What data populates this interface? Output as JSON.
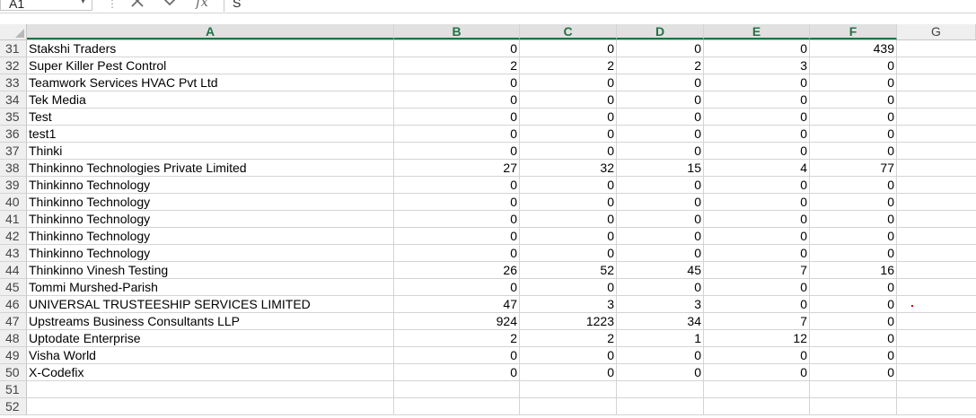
{
  "formula_bar": {
    "name_box": "A1",
    "formula": "S",
    "fx_label": "fx"
  },
  "columns": [
    "A",
    "B",
    "C",
    "D",
    "E",
    "F",
    "G"
  ],
  "rows": [
    {
      "n": "31",
      "a": "Stakshi Traders",
      "b": "0",
      "c": "0",
      "d": "0",
      "e": "0",
      "f": "439"
    },
    {
      "n": "32",
      "a": "Super Killer Pest Control",
      "b": "2",
      "c": "2",
      "d": "2",
      "e": "3",
      "f": "0"
    },
    {
      "n": "33",
      "a": "Teamwork Services HVAC Pvt Ltd",
      "b": "0",
      "c": "0",
      "d": "0",
      "e": "0",
      "f": "0"
    },
    {
      "n": "34",
      "a": "Tek Media",
      "b": "0",
      "c": "0",
      "d": "0",
      "e": "0",
      "f": "0"
    },
    {
      "n": "35",
      "a": "Test",
      "b": "0",
      "c": "0",
      "d": "0",
      "e": "0",
      "f": "0"
    },
    {
      "n": "36",
      "a": "test1",
      "b": "0",
      "c": "0",
      "d": "0",
      "e": "0",
      "f": "0"
    },
    {
      "n": "37",
      "a": "Thinki",
      "b": "0",
      "c": "0",
      "d": "0",
      "e": "0",
      "f": "0"
    },
    {
      "n": "38",
      "a": "Thinkinno Technologies Private Limited",
      "b": "27",
      "c": "32",
      "d": "15",
      "e": "4",
      "f": "77"
    },
    {
      "n": "39",
      "a": "Thinkinno Technology",
      "b": "0",
      "c": "0",
      "d": "0",
      "e": "0",
      "f": "0"
    },
    {
      "n": "40",
      "a": "Thinkinno Technology",
      "b": "0",
      "c": "0",
      "d": "0",
      "e": "0",
      "f": "0"
    },
    {
      "n": "41",
      "a": "Thinkinno Technology",
      "b": "0",
      "c": "0",
      "d": "0",
      "e": "0",
      "f": "0"
    },
    {
      "n": "42",
      "a": "Thinkinno Technology",
      "b": "0",
      "c": "0",
      "d": "0",
      "e": "0",
      "f": "0"
    },
    {
      "n": "43",
      "a": "Thinkinno Technology",
      "b": "0",
      "c": "0",
      "d": "0",
      "e": "0",
      "f": "0"
    },
    {
      "n": "44",
      "a": "Thinkinno Vinesh Testing",
      "b": "26",
      "c": "52",
      "d": "45",
      "e": "7",
      "f": "16"
    },
    {
      "n": "45",
      "a": "Tommi Murshed-Parish",
      "b": "0",
      "c": "0",
      "d": "0",
      "e": "0",
      "f": "0"
    },
    {
      "n": "46",
      "a": "UNIVERSAL TRUSTEESHIP SERVICES LIMITED",
      "b": "47",
      "c": "3",
      "d": "3",
      "e": "0",
      "f": "0"
    },
    {
      "n": "47",
      "a": "Upstreams Business Consultants LLP",
      "b": "924",
      "c": "1223",
      "d": "34",
      "e": "7",
      "f": "0"
    },
    {
      "n": "48",
      "a": "Uptodate Enterprise",
      "b": "2",
      "c": "2",
      "d": "1",
      "e": "12",
      "f": "0"
    },
    {
      "n": "49",
      "a": "Visha World",
      "b": "0",
      "c": "0",
      "d": "0",
      "e": "0",
      "f": "0"
    },
    {
      "n": "50",
      "a": "X-Codefix",
      "b": "0",
      "c": "0",
      "d": "0",
      "e": "0",
      "f": "0"
    },
    {
      "n": "51",
      "a": "",
      "b": "",
      "c": "",
      "d": "",
      "e": "",
      "f": ""
    },
    {
      "n": "52",
      "a": "",
      "b": "",
      "c": "",
      "d": "",
      "e": "",
      "f": ""
    }
  ]
}
